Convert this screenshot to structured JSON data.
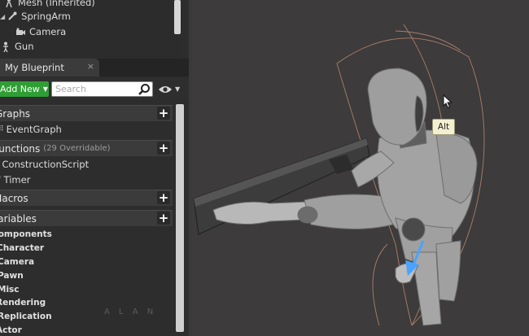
{
  "components_tree": {
    "items": [
      {
        "label": "Mesh (Inherited)",
        "icon": "mesh-icon"
      },
      {
        "label": "SpringArm",
        "icon": "spring-arm-icon"
      },
      {
        "label": "Camera",
        "icon": "camera-icon"
      },
      {
        "label": "Gun",
        "icon": "person-icon"
      }
    ]
  },
  "tab": {
    "label": "My Blueprint",
    "close": "×"
  },
  "toolbar": {
    "add_label": "Add New",
    "search_placeholder": "Search"
  },
  "sections": {
    "graphs": {
      "label": "Graphs",
      "items": [
        "EventGraph"
      ]
    },
    "functions": {
      "label": "Functions",
      "sub": "(29 Overridable)",
      "items": [
        "ConstructionScript",
        "Timer"
      ]
    },
    "macros": {
      "label": "Macros"
    },
    "variables": {
      "label": "Variables",
      "categories": [
        "Components",
        "Character",
        "Camera",
        "Pawn",
        "Misc",
        "Rendering",
        "Replication",
        "Actor"
      ]
    }
  },
  "watermark": "A L A N",
  "viewport": {
    "tooltip": "Alt"
  },
  "colors": {
    "add_button": "#2f9e34",
    "panel_bg": "#2d2d2d",
    "viewport_bg": "#3d3b3b",
    "tooltip_bg": "#f3f0d2"
  }
}
